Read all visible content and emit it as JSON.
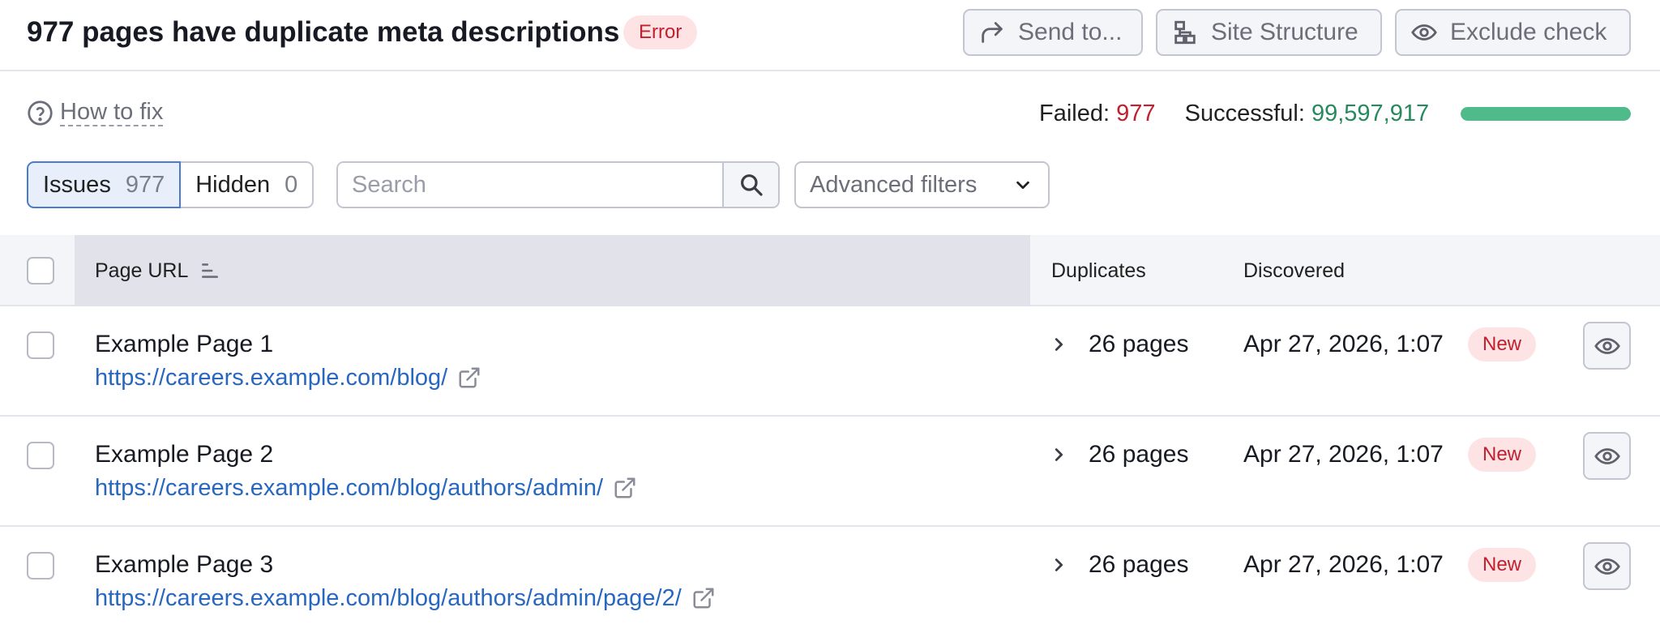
{
  "header": {
    "title": "977 pages have duplicate meta descriptions",
    "badge": "Error",
    "buttons": {
      "send_to": "Send to...",
      "site_structure": "Site Structure",
      "exclude_check": "Exclude check"
    }
  },
  "how_to_fix": "How to fix",
  "stats": {
    "failed_label": "Failed:",
    "failed_value": "977",
    "successful_label": "Successful:",
    "successful_value": "99,597,917",
    "success_ratio": 0.99999
  },
  "filters": {
    "issues_label": "Issues",
    "issues_count": "977",
    "hidden_label": "Hidden",
    "hidden_count": "0",
    "search_placeholder": "Search",
    "advanced_label": "Advanced filters"
  },
  "table": {
    "columns": {
      "page_url": "Page URL",
      "duplicates": "Duplicates",
      "discovered": "Discovered"
    },
    "rows": [
      {
        "name": "Example Page 1",
        "url": "https://careers.example.com/blog/",
        "duplicates": "26 pages",
        "discovered": "Apr 27, 2026, 1:07",
        "badge": "New"
      },
      {
        "name": "Example Page 2",
        "url": "https://careers.example.com/blog/authors/admin/",
        "duplicates": "26 pages",
        "discovered": "Apr 27, 2026, 1:07",
        "badge": "New"
      },
      {
        "name": "Example Page 3",
        "url": "https://careers.example.com/blog/authors/admin/page/2/",
        "duplicates": "26 pages",
        "discovered": "Apr 27, 2026, 1:07",
        "badge": "New"
      }
    ]
  },
  "icons": {
    "send": "share-arrow-icon",
    "structure": "site-structure-icon",
    "exclude": "eye-icon",
    "help": "question-circle-icon",
    "search": "search-icon",
    "dropdown": "chevron-down-icon",
    "sort": "sort-icon",
    "external": "external-link-icon",
    "expand": "chevron-right-icon",
    "hide": "eye-icon"
  },
  "colors": {
    "error_text": "#c21f2f",
    "error_bg": "#fde3e4",
    "success_text": "#278a5e",
    "progress_fill": "#4fbb8a",
    "link": "#2767c0",
    "active_border": "#4a7bd1"
  }
}
